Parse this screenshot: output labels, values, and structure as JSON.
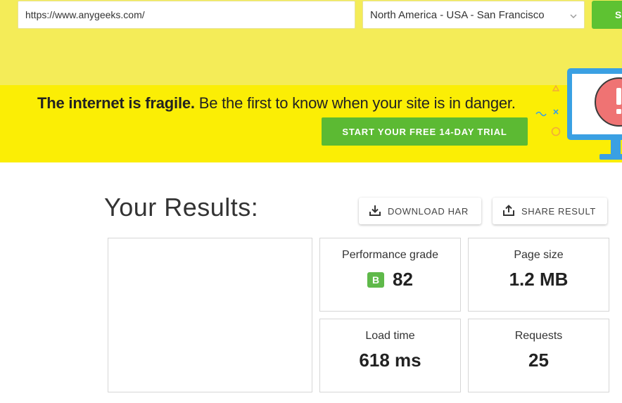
{
  "test_form": {
    "url_value": "https://www.anygeeks.com/",
    "location_selected": "North America - USA - San Francisco",
    "start_label": "S"
  },
  "banner": {
    "headline_bold": "The internet is fragile.",
    "headline_rest": " Be the first to know when your site is in danger.",
    "cta_label": "START YOUR FREE 14-DAY TRIAL"
  },
  "results": {
    "title": "Your Results:",
    "download_label": "DOWNLOAD HAR",
    "share_label": "SHARE RESULT"
  },
  "metrics": {
    "performance": {
      "label": "Performance grade",
      "grade": "B",
      "value": "82"
    },
    "page_size": {
      "label": "Page size",
      "value": "1.2 MB"
    },
    "load_time": {
      "label": "Load time",
      "value": "618 ms"
    },
    "requests": {
      "label": "Requests",
      "value": "25"
    }
  },
  "colors": {
    "top_strip": "#f4ec58",
    "banner": "#fbee05",
    "accent_green": "#5cba33",
    "grade_green": "#5fb94a"
  },
  "icons": {
    "location_chevron": "chevron-down-icon",
    "download": "download-icon",
    "share": "share-icon",
    "illustration": "alert-monitor-illustration"
  }
}
